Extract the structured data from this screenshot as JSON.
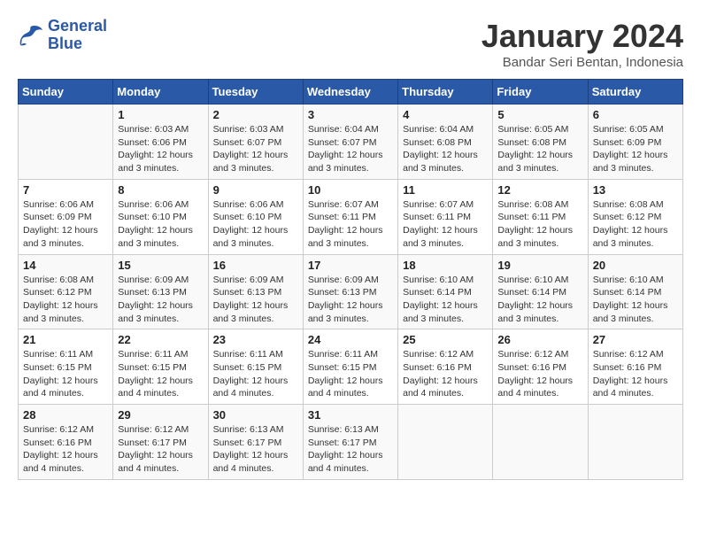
{
  "header": {
    "logo_line1": "General",
    "logo_line2": "Blue",
    "month": "January 2024",
    "location": "Bandar Seri Bentan, Indonesia"
  },
  "days_of_week": [
    "Sunday",
    "Monday",
    "Tuesday",
    "Wednesday",
    "Thursday",
    "Friday",
    "Saturday"
  ],
  "weeks": [
    [
      {
        "day": "",
        "info": ""
      },
      {
        "day": "1",
        "info": "Sunrise: 6:03 AM\nSunset: 6:06 PM\nDaylight: 12 hours\nand 3 minutes."
      },
      {
        "day": "2",
        "info": "Sunrise: 6:03 AM\nSunset: 6:07 PM\nDaylight: 12 hours\nand 3 minutes."
      },
      {
        "day": "3",
        "info": "Sunrise: 6:04 AM\nSunset: 6:07 PM\nDaylight: 12 hours\nand 3 minutes."
      },
      {
        "day": "4",
        "info": "Sunrise: 6:04 AM\nSunset: 6:08 PM\nDaylight: 12 hours\nand 3 minutes."
      },
      {
        "day": "5",
        "info": "Sunrise: 6:05 AM\nSunset: 6:08 PM\nDaylight: 12 hours\nand 3 minutes."
      },
      {
        "day": "6",
        "info": "Sunrise: 6:05 AM\nSunset: 6:09 PM\nDaylight: 12 hours\nand 3 minutes."
      }
    ],
    [
      {
        "day": "7",
        "info": "Sunrise: 6:06 AM\nSunset: 6:09 PM\nDaylight: 12 hours\nand 3 minutes."
      },
      {
        "day": "8",
        "info": "Sunrise: 6:06 AM\nSunset: 6:10 PM\nDaylight: 12 hours\nand 3 minutes."
      },
      {
        "day": "9",
        "info": "Sunrise: 6:06 AM\nSunset: 6:10 PM\nDaylight: 12 hours\nand 3 minutes."
      },
      {
        "day": "10",
        "info": "Sunrise: 6:07 AM\nSunset: 6:11 PM\nDaylight: 12 hours\nand 3 minutes."
      },
      {
        "day": "11",
        "info": "Sunrise: 6:07 AM\nSunset: 6:11 PM\nDaylight: 12 hours\nand 3 minutes."
      },
      {
        "day": "12",
        "info": "Sunrise: 6:08 AM\nSunset: 6:11 PM\nDaylight: 12 hours\nand 3 minutes."
      },
      {
        "day": "13",
        "info": "Sunrise: 6:08 AM\nSunset: 6:12 PM\nDaylight: 12 hours\nand 3 minutes."
      }
    ],
    [
      {
        "day": "14",
        "info": "Sunrise: 6:08 AM\nSunset: 6:12 PM\nDaylight: 12 hours\nand 3 minutes."
      },
      {
        "day": "15",
        "info": "Sunrise: 6:09 AM\nSunset: 6:13 PM\nDaylight: 12 hours\nand 3 minutes."
      },
      {
        "day": "16",
        "info": "Sunrise: 6:09 AM\nSunset: 6:13 PM\nDaylight: 12 hours\nand 3 minutes."
      },
      {
        "day": "17",
        "info": "Sunrise: 6:09 AM\nSunset: 6:13 PM\nDaylight: 12 hours\nand 3 minutes."
      },
      {
        "day": "18",
        "info": "Sunrise: 6:10 AM\nSunset: 6:14 PM\nDaylight: 12 hours\nand 3 minutes."
      },
      {
        "day": "19",
        "info": "Sunrise: 6:10 AM\nSunset: 6:14 PM\nDaylight: 12 hours\nand 3 minutes."
      },
      {
        "day": "20",
        "info": "Sunrise: 6:10 AM\nSunset: 6:14 PM\nDaylight: 12 hours\nand 3 minutes."
      }
    ],
    [
      {
        "day": "21",
        "info": "Sunrise: 6:11 AM\nSunset: 6:15 PM\nDaylight: 12 hours\nand 4 minutes."
      },
      {
        "day": "22",
        "info": "Sunrise: 6:11 AM\nSunset: 6:15 PM\nDaylight: 12 hours\nand 4 minutes."
      },
      {
        "day": "23",
        "info": "Sunrise: 6:11 AM\nSunset: 6:15 PM\nDaylight: 12 hours\nand 4 minutes."
      },
      {
        "day": "24",
        "info": "Sunrise: 6:11 AM\nSunset: 6:15 PM\nDaylight: 12 hours\nand 4 minutes."
      },
      {
        "day": "25",
        "info": "Sunrise: 6:12 AM\nSunset: 6:16 PM\nDaylight: 12 hours\nand 4 minutes."
      },
      {
        "day": "26",
        "info": "Sunrise: 6:12 AM\nSunset: 6:16 PM\nDaylight: 12 hours\nand 4 minutes."
      },
      {
        "day": "27",
        "info": "Sunrise: 6:12 AM\nSunset: 6:16 PM\nDaylight: 12 hours\nand 4 minutes."
      }
    ],
    [
      {
        "day": "28",
        "info": "Sunrise: 6:12 AM\nSunset: 6:16 PM\nDaylight: 12 hours\nand 4 minutes."
      },
      {
        "day": "29",
        "info": "Sunrise: 6:12 AM\nSunset: 6:17 PM\nDaylight: 12 hours\nand 4 minutes."
      },
      {
        "day": "30",
        "info": "Sunrise: 6:13 AM\nSunset: 6:17 PM\nDaylight: 12 hours\nand 4 minutes."
      },
      {
        "day": "31",
        "info": "Sunrise: 6:13 AM\nSunset: 6:17 PM\nDaylight: 12 hours\nand 4 minutes."
      },
      {
        "day": "",
        "info": ""
      },
      {
        "day": "",
        "info": ""
      },
      {
        "day": "",
        "info": ""
      }
    ]
  ]
}
